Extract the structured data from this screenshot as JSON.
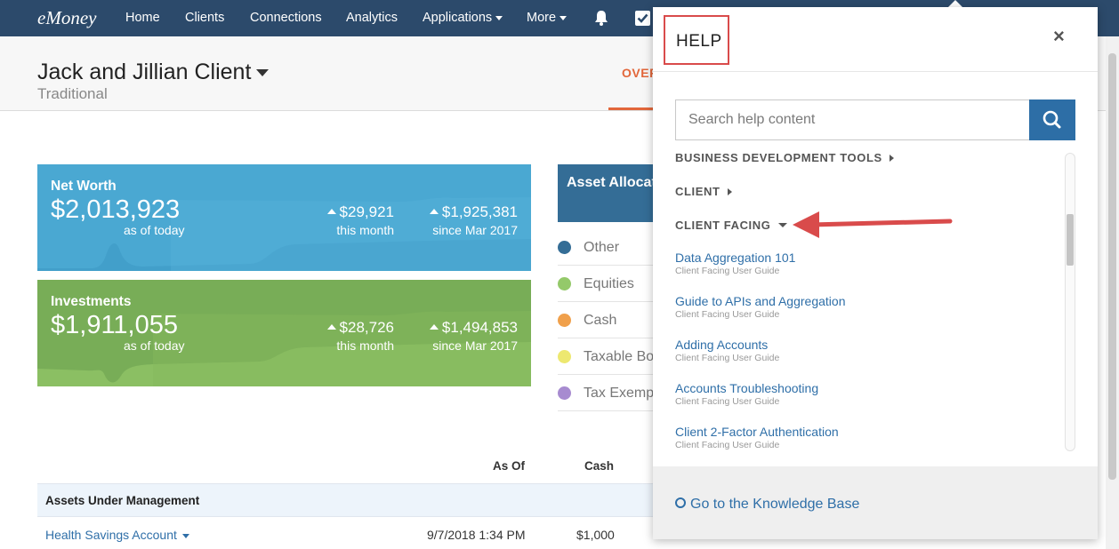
{
  "nav": {
    "logo": "eMoney",
    "home": "Home",
    "clients": "Clients",
    "connections": "Connections",
    "analytics": "Analytics",
    "applications": "Applications",
    "more": "More"
  },
  "client": {
    "name": "Jack and Jillian Client",
    "type": "Traditional",
    "tab_overview": "OVER"
  },
  "net_worth": {
    "title": "Net Worth",
    "value": "$2,013,923",
    "as_of": "as of today",
    "month_change": "$29,921",
    "month_label": "this month",
    "since_change": "$1,925,381",
    "since_label": "since Mar 2017"
  },
  "investments": {
    "title": "Investments",
    "value": "$1,911,055",
    "as_of": "as of today",
    "month_change": "$28,726",
    "month_label": "this month",
    "since_change": "$1,494,853",
    "since_label": "since Mar 2017"
  },
  "allocation": {
    "title": "Asset Allocation",
    "items": [
      {
        "label": "Other",
        "color": "#346d96"
      },
      {
        "label": "Equities",
        "color": "#94c96a"
      },
      {
        "label": "Cash",
        "color": "#f0a04b"
      },
      {
        "label": "Taxable Bonds",
        "color": "#ede870"
      },
      {
        "label": "Tax Exempt",
        "color": "#a78bd0"
      }
    ]
  },
  "table": {
    "col_as_of": "As Of",
    "col_cash": "Cash",
    "section": "Assets Under Management",
    "rows": [
      {
        "name": "Health Savings Account",
        "as_of": "9/7/2018 1:34 PM",
        "cash": "$1,000"
      }
    ]
  },
  "help": {
    "title": "HELP",
    "close": "×",
    "search_placeholder": "Search help content",
    "categories": [
      {
        "label": "BUSINESS DEVELOPMENT TOOLS",
        "expanded": false
      },
      {
        "label": "CLIENT",
        "expanded": false
      },
      {
        "label": "CLIENT FACING",
        "expanded": true
      }
    ],
    "articles": [
      {
        "title": "Data Aggregation 101",
        "subtitle": "Client Facing User Guide"
      },
      {
        "title": "Guide to APIs and Aggregation",
        "subtitle": "Client Facing User Guide"
      },
      {
        "title": "Adding Accounts",
        "subtitle": "Client Facing User Guide"
      },
      {
        "title": "Accounts Troubleshooting",
        "subtitle": "Client Facing User Guide"
      },
      {
        "title": "Client 2-Factor Authentication",
        "subtitle": "Client Facing User Guide"
      }
    ],
    "kb_link": "Go to the Knowledge Base"
  },
  "colors": {
    "nav_bg": "#2c4a6b",
    "accent": "#e2673b",
    "net_worth_card": "#4aa8d2",
    "investments_card": "#78ad57",
    "link": "#2f6fa8",
    "annotation_red": "#d94b4b"
  }
}
